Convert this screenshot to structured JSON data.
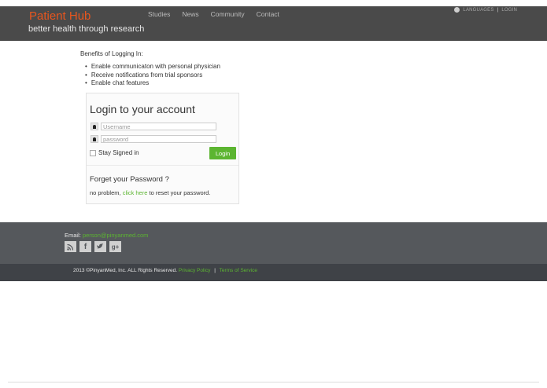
{
  "header": {
    "brand": "Patient Hub",
    "tagline": "better health through research",
    "nav": [
      "Studies",
      "News",
      "Community",
      "Contact"
    ],
    "languages": "LANGUAGES",
    "login": "LOGIN",
    "separator": "|"
  },
  "benefits": {
    "title": "Benefits of Logging In:",
    "items": [
      "Enable communicaton with personal physician",
      "Receive notifications from trial sponsors",
      "Enable chat features"
    ]
  },
  "login_form": {
    "title": "Login to your account",
    "username_placeholder": "Username",
    "password_placeholder": "password",
    "stay_signed_in": "Stay Signed in",
    "login_button": "Login",
    "forgot_title": "Forget your Password ?",
    "forgot_prefix": "no problem,",
    "forgot_link": "click here",
    "forgot_suffix": "to reset your password."
  },
  "footer": {
    "email_label": "Email:",
    "email": "person@pinyanmed.com",
    "social": [
      "rss",
      "f",
      "twitter",
      "g+"
    ],
    "copyright": "2013 ©PinyanMed, Inc. ALL Rights Reserved.",
    "privacy": "Privacy Policy",
    "pipe": "|",
    "terms": "Terms of Service"
  },
  "colors": {
    "brand": "#e8561e",
    "accent": "#5cb531",
    "header_bg": "#4a4a4a",
    "footer_bg": "#55585c"
  }
}
